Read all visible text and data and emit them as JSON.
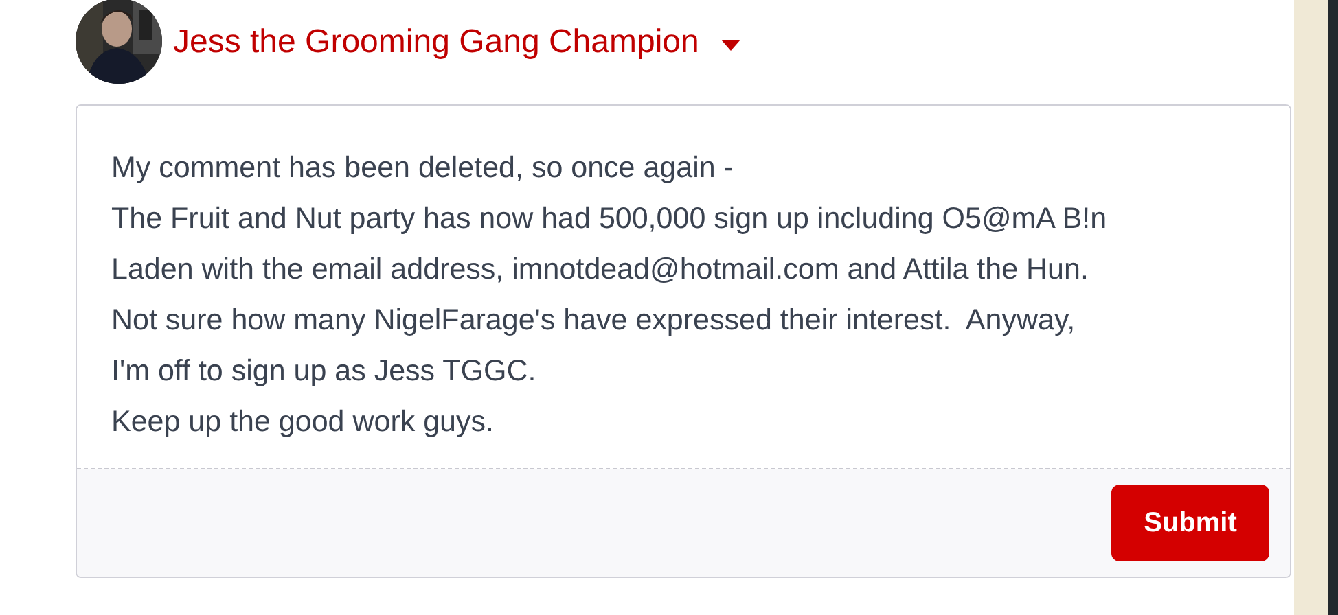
{
  "author": {
    "name": "Jess the Grooming Gang Champion"
  },
  "comment_box": {
    "lines": [
      "My comment has been deleted, so once again -",
      "The Fruit and Nut party has now had 500,000 sign up including O5@mA B!n",
      "Laden with the email address, imnotdead@hotmail.com and Attila the Hun.",
      "Not sure how many NigelFarage's have expressed their interest.  Anyway,",
      "I'm off to sign up as Jess TGGC.",
      "Keep up the good work guys."
    ]
  },
  "submit_button": "Submit"
}
